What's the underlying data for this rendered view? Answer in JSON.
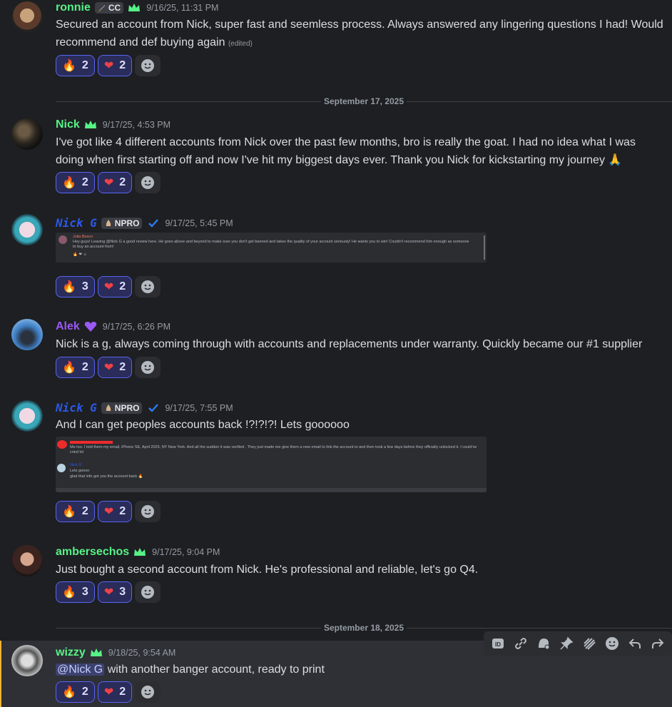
{
  "messages": [
    {
      "user": "ronnie",
      "badge": "CC",
      "time": "9/16/25, 11:31 PM",
      "text": "Secured an account from Nick, super fast and seemless process. Always answered any lingering questions I had! Would recommend and def buying again",
      "edited": "(edited)",
      "fire": "2",
      "heart": "2"
    },
    {
      "user": "Nick",
      "time": "9/17/25, 4:53 PM",
      "text": "I've got like 4 different accounts from Nick over the past few months, bro is really the goat. I had no idea what I was doing when first starting off and now I've hit my biggest days ever. Thank you Nick for kickstarting my journey 🙏",
      "fire": "2",
      "heart": "2"
    },
    {
      "user": "Nick G",
      "badge": "NPRO",
      "time": "9/17/25, 5:45 PM",
      "embed_user": "Julia Bosco",
      "embed_text": "Hey guys! Leaving @Nick G a good review here. He goes above and beyond to make sure you don't get banned and takes the quality of your account seriously! He wants you to win! Couldn't recommend him enough as someone to buy an account from!",
      "fire": "3",
      "heart": "2"
    },
    {
      "user": "Alek",
      "time": "9/17/25, 6:26 PM",
      "text": "Nick is a g, always coming through with accounts and replacements under warranty. Quickly became our #1 supplier",
      "fire": "2",
      "heart": "2"
    },
    {
      "user": "Nick G",
      "badge": "NPRO",
      "time": "9/17/25, 7:55 PM",
      "text": "And I can get peoples accounts back !?!?!?! Lets goooooo",
      "embed_text1": "Me too. I told them my email, iPhone SE, April 2025, NY New York. And all the sudden it was verified . They just made me give them a new email to link the account to and then took a few days before they officially unlocked it. I could've cried lol",
      "embed_user2": "Nick G",
      "embed_text2a": "Lets goooo",
      "embed_text2b": "glad that info got you the account back 🔥",
      "fire": "2",
      "heart": "2"
    },
    {
      "user": "ambersechos",
      "time": "9/17/25, 9:04 PM",
      "text": "Just bought a second account from Nick. He's professional and reliable, let's go Q4.",
      "fire": "3",
      "heart": "3"
    },
    {
      "user": "wizzy",
      "time": "9/18/25, 9:54 AM",
      "mention": "@Nick G",
      "text": " with another banger account, ready to print",
      "fire": "2",
      "heart": "2"
    }
  ],
  "dividers": [
    "September 17, 2025",
    "September 18, 2025"
  ],
  "colors": {
    "green_name": "#57f287",
    "blue_name": "#2b59e8",
    "purple_name": "#9b59f6",
    "accent": "#5865f2"
  },
  "toolbar_icons": [
    "app-id-icon",
    "link-icon",
    "thread-icon",
    "pin-icon",
    "lines-icon",
    "emoji-icon",
    "reply-icon",
    "forward-icon"
  ]
}
